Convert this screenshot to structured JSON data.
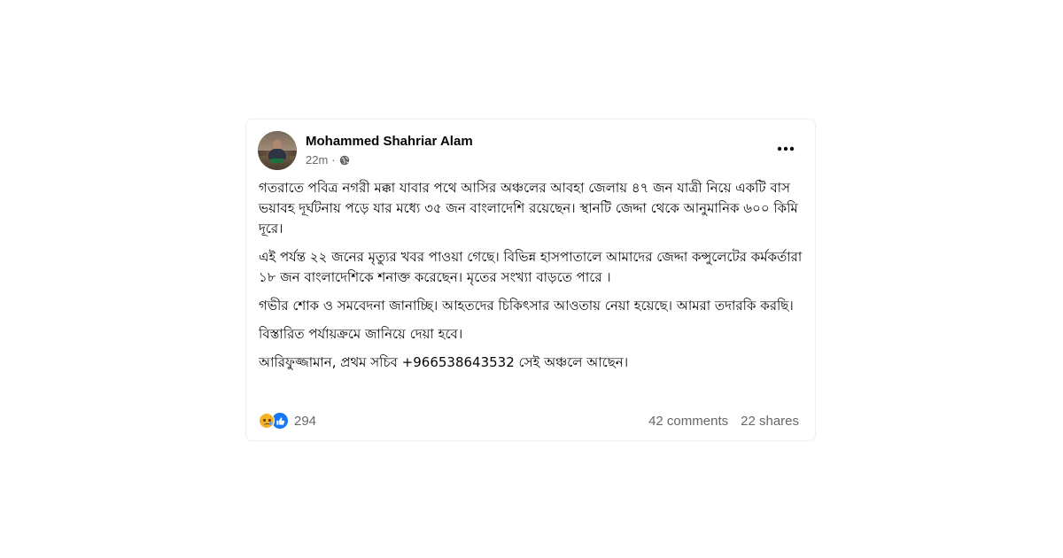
{
  "post": {
    "author": "Mohammed Shahriar Alam",
    "time": "22m",
    "separator": "·",
    "privacy_icon": "globe-icon",
    "more_icon": "more-options-icon",
    "paragraphs": [
      "গতরাতে পবিত্র নগরী মক্কা যাবার পথে আসির অঞ্চলের আবহা জেলায় ৪৭ জন যাত্রী নিয়ে একটি বাস ভয়াবহ দূর্ঘটনায় পড়ে যার মধ্যে ৩৫ জন বাংলাদেশি রয়েছেন। স্থানটি জেদ্দা থেকে আনুমানিক ৬০০ কিমি দূরে।",
      "এই পর্যন্ত ২২ জনের মৃত্যুর খবর পাওয়া গেছে। বিভিন্ন হাসপাতালে আমাদের জেদ্দা কন্সুলেটের কর্মকর্তারা ১৮ জন বাংলাদেশিকে শনাক্ত করেছেন। মৃতের সংখ্যা বাড়তে পারে ।",
      "গভীর শোক ও সমবেদনা জানাচ্ছি। আহতদের চিকিৎসার আওতায় নেয়া হয়েছে। আমরা তদারকি করছি।",
      "বিস্তারিত পর্যায়ক্রমে জানিয়ে দেয়া হবে।",
      "আরিফুজ্জামান, প্রথম সচিব +966538643532 সেই অঞ্চলে আছেন।"
    ],
    "reaction_icons": [
      "sad-reaction-icon",
      "like-reaction-icon"
    ],
    "reaction_count": "294",
    "comments": "42 comments",
    "shares": "22 shares"
  },
  "colors": {
    "text_primary": "#050505",
    "text_secondary": "#65676b",
    "like_blue": "#1877f2",
    "sad_yellow": "#f7b125"
  }
}
